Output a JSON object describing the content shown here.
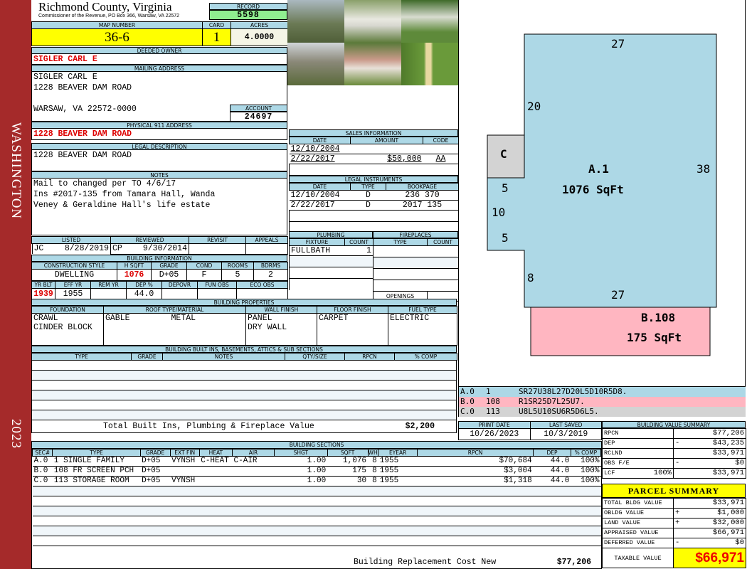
{
  "side": {
    "district": "WASHINGTON",
    "year": "2023"
  },
  "header": {
    "county": "Richmond County, Virginia",
    "subtitle": "Commissioner of the Revenue, PO Box 366, Warsaw, VA 22572",
    "record_label": "RECORD",
    "record": "5598",
    "map_label": "MAP NUMBER",
    "map": "36-6",
    "card_label": "CARD",
    "card": "1",
    "acres_label": "ACRES",
    "acres": "4.0000"
  },
  "owner": {
    "label": "DEEDED OWNER",
    "name": "SIGLER CARL E"
  },
  "mailing": {
    "label": "MAILING ADDRESS",
    "lines": [
      "SIGLER CARL E",
      "1228 BEAVER DAM ROAD",
      "",
      "WARSAW, VA 22572-0000"
    ],
    "account_label": "ACCOUNT",
    "account": "24697"
  },
  "physical": {
    "label": "PHYSICAL 911 ADDRESS",
    "value": "1228 BEAVER DAM ROAD"
  },
  "legal": {
    "label": "LEGAL DESCRIPTION",
    "value": "1228 BEAVER DAM ROAD"
  },
  "notes": {
    "label": "NOTES",
    "lines": [
      "Mail to changed per TO 4/6/17",
      "Ins #2017-135 from Tamara Hall, Wanda",
      "Veney & Geraldine Hall's life estate"
    ]
  },
  "review": {
    "headers": [
      "LISTED",
      "REVIEWED",
      "REVISIT",
      "APPEALS"
    ],
    "listed_by": "JC",
    "listed": "8/28/2019",
    "reviewed_by": "CP",
    "reviewed": "9/30/2014"
  },
  "building_info": {
    "label": "BUILDING INFORMATION",
    "h1": [
      "CONSTRUCTION STYLE",
      "H SQFT",
      "GRADE",
      "COND",
      "ROOMS",
      "BDRMS"
    ],
    "v1": [
      "DWELLING",
      "1076",
      "D+05",
      "F",
      "5",
      "2"
    ],
    "h2": [
      "YR BLT",
      "EFF YR",
      "REM YR",
      "DEP %",
      "DEPOVR",
      "FUN OBS",
      "ECO OBS"
    ],
    "v2": [
      "1939",
      "1955",
      "",
      "44.0",
      "",
      "",
      ""
    ]
  },
  "sales": {
    "label": "SALES INFORMATION",
    "headers": [
      "DATE",
      "AMOUNT",
      "CODE"
    ],
    "rows": [
      [
        "12/10/2004",
        "",
        ""
      ],
      [
        "2/22/2017",
        "$50,000",
        "AA"
      ]
    ]
  },
  "instruments": {
    "label": "LEGAL INSTRUMENTS",
    "headers": [
      "DATE",
      "TYPE",
      "BOOKPAGE"
    ],
    "rows": [
      [
        "12/10/2004",
        "D",
        "236 370"
      ],
      [
        "2/22/2017",
        "D",
        "2017 135"
      ]
    ]
  },
  "plumbing": {
    "label": "PLUMBING",
    "headers": [
      "FIXTURE",
      "COUNT"
    ],
    "rows": [
      [
        "FULLBATH",
        "1"
      ]
    ]
  },
  "fireplaces": {
    "label": "FIREPLACES",
    "headers": [
      "TYPE",
      "COUNT"
    ],
    "openings": "OPENINGS"
  },
  "properties": {
    "label": "BUILDING PROPERTIES",
    "headers": [
      "FOUNDATION",
      "ROOF TYPE/MATERIAL",
      "WALL FINISH",
      "FLOOR FINISH",
      "FUEL TYPE"
    ],
    "foundation": [
      "CRAWL",
      "CINDER BLOCK"
    ],
    "roof_type": "GABLE",
    "roof_material": "METAL",
    "wall": [
      "PANEL",
      "DRY WALL"
    ],
    "floor": "CARPET",
    "fuel": "ELECTRIC"
  },
  "builtins": {
    "label": "BUILDING BUILT INS, BASEMENTS, ATTICS & SUB SECTIONS",
    "headers": [
      "TYPE",
      "GRADE",
      "NOTES",
      "QTY/SIZE",
      "RPCN",
      "% COMP"
    ],
    "total_label": "Total Built Ins, Plumbing & Fireplace Value",
    "total": "$2,200"
  },
  "dates": {
    "print_label": "PRINT DATE",
    "print": "10/26/2023",
    "saved_label": "LAST SAVED",
    "saved": "10/3/2019"
  },
  "sections": {
    "label": "BUILDING SECTIONS",
    "headers": [
      "SEC#",
      "TYPE",
      "GRADE",
      "EXT FIN",
      "HEAT",
      "AIR",
      "SHGT",
      "SQFT",
      "WHGT",
      "EYEAR",
      "RPCN",
      "DEP",
      "% COMP"
    ],
    "rows": [
      [
        "A.0",
        "1 SINGLE FAMILY",
        "D+05",
        "VYNSH",
        "C-HEAT",
        "C-AIR",
        "1.00",
        "1,076",
        "8",
        "1955",
        "$70,684",
        "44.0",
        "100%"
      ],
      [
        "B.0",
        "108 FR SCREEN PCH",
        "D+05",
        "",
        "",
        "",
        "1.00",
        "175",
        "8",
        "1955",
        "$3,004",
        "44.0",
        "100%"
      ],
      [
        "C.0",
        "113 STORAGE ROOM",
        "D+05",
        "VYNSH",
        "",
        "",
        "1.00",
        "30",
        "8",
        "1955",
        "$1,318",
        "44.0",
        "100%"
      ]
    ],
    "replacement_label": "Building Replacement Cost New",
    "replacement": "$77,206"
  },
  "sketch": {
    "a_label": "A.1",
    "a_area": "1076 SqFt",
    "b_label": "B.108",
    "b_area": "175 SqFt",
    "c_label": "C",
    "dims": {
      "top": "27",
      "right": "38",
      "bottom": "27",
      "left_upper": "20",
      "notch_top": "5",
      "notch_side": "10",
      "notch_bottom": "5",
      "left_lower": "8"
    },
    "colors": {
      "a": "#add8e6",
      "b": "#ffb6c1",
      "c": "#d3d3d3"
    },
    "vectors": [
      [
        "A.0",
        "1",
        "SR27U38L27D20L5D10R5D8."
      ],
      [
        "B.0",
        "108",
        "R1SR25D7L25U7."
      ],
      [
        "C.0",
        "113",
        "U8L5U10SU6R5D6L5."
      ]
    ]
  },
  "value_summary": {
    "label": "BUILDING VALUE SUMMARY",
    "rows": [
      [
        "RPCN",
        "",
        "",
        "$77,206"
      ],
      [
        "DEP",
        "",
        "-",
        "$43,235"
      ],
      [
        "RCLND",
        "",
        "",
        "$33,971"
      ],
      [
        "OBS F/E",
        "",
        "-",
        "$0"
      ],
      [
        "LCF",
        "100%",
        "",
        "$33,971"
      ]
    ]
  },
  "parcel": {
    "label": "PARCEL SUMMARY",
    "rows": [
      [
        "TOTAL BLDG VALUE",
        "",
        "$33,971"
      ],
      [
        "OBLDG VALUE",
        "+",
        "$1,000"
      ],
      [
        "LAND VALUE",
        "+",
        "$32,000"
      ],
      [
        "APPRAISED VALUE",
        "",
        "$66,971"
      ],
      [
        "DEFERRED VALUE",
        "-",
        "$0"
      ]
    ],
    "taxable_label": "TAXABLE VALUE",
    "taxable": "$66,971"
  }
}
